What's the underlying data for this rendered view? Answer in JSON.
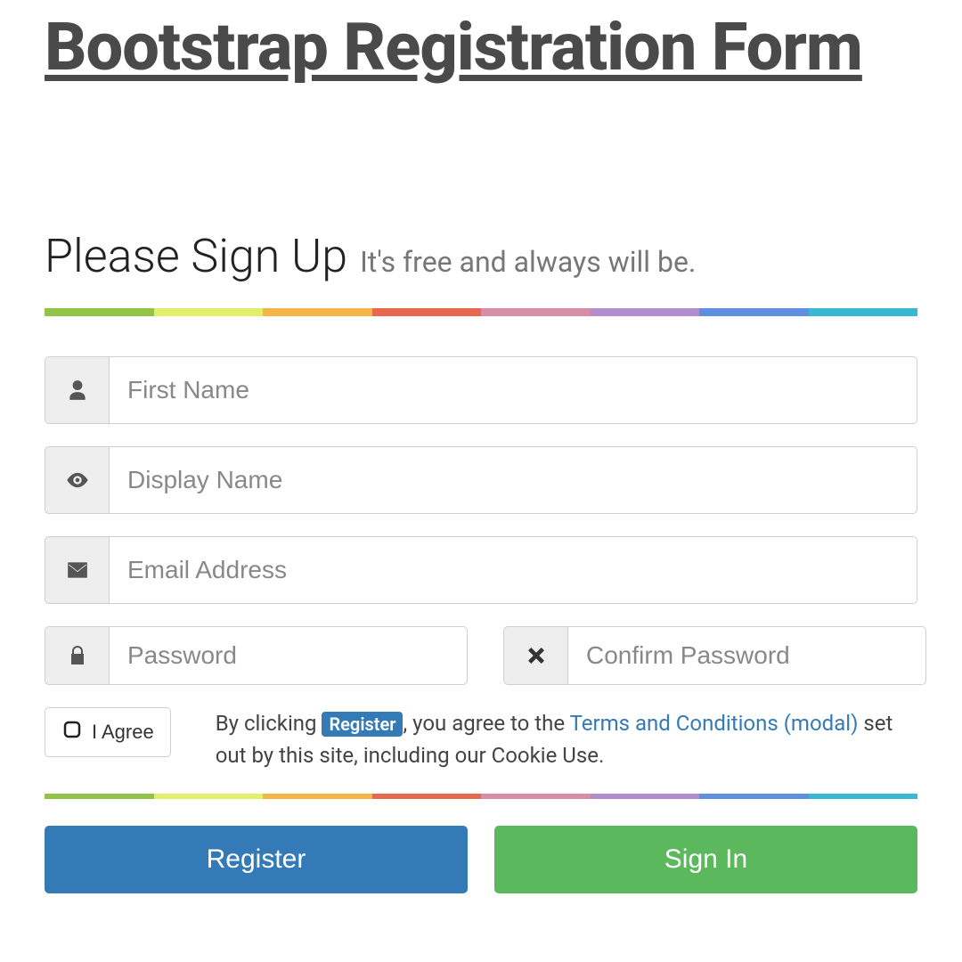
{
  "title": "Bootstrap Registration Form",
  "header": {
    "main": "Please Sign Up",
    "sub": "It's free and always will be."
  },
  "fields": {
    "first_name": {
      "placeholder": "First Name"
    },
    "display_name": {
      "placeholder": "Display Name"
    },
    "email": {
      "placeholder": "Email Address"
    },
    "password": {
      "placeholder": "Password"
    },
    "confirm_password": {
      "placeholder": "Confirm Password"
    }
  },
  "agree": {
    "label": "I Agree"
  },
  "disclaimer": {
    "pre": "By clicking ",
    "badge": "Register",
    "mid": ", you agree to the ",
    "link1": "Terms and Conditions",
    "link2": "(modal)",
    "post": " set out by this site, including our Cookie Use."
  },
  "buttons": {
    "register": "Register",
    "signin": "Sign In"
  }
}
